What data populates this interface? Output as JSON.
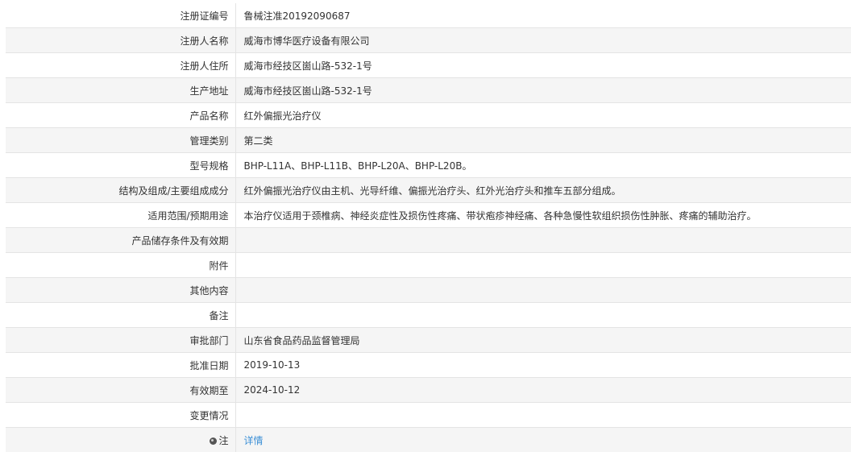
{
  "rows": [
    {
      "label": "注册证编号",
      "value": "鲁械注准20192090687"
    },
    {
      "label": "注册人名称",
      "value": "威海市博华医疗设备有限公司"
    },
    {
      "label": "注册人住所",
      "value": "威海市经技区崮山路-532-1号"
    },
    {
      "label": "生产地址",
      "value": "威海市经技区崮山路-532-1号"
    },
    {
      "label": "产品名称",
      "value": "红外偏振光治疗仪"
    },
    {
      "label": "管理类别",
      "value": "第二类"
    },
    {
      "label": "型号规格",
      "value": "BHP-L11A、BHP-L11B、BHP-L20A、BHP-L20B。"
    },
    {
      "label": "结构及组成/主要组成成分",
      "value": "红外偏振光治疗仪由主机、光导纤维、偏振光治疗头、红外光治疗头和推车五部分组成。"
    },
    {
      "label": "适用范围/预期用途",
      "value": "本治疗仪适用于颈椎病、神经炎症性及损伤性疼痛、带状疱疹神经痛、各种急慢性软组织损伤性肿胀、疼痛的辅助治疗。"
    },
    {
      "label": "产品储存条件及有效期",
      "value": ""
    },
    {
      "label": "附件",
      "value": ""
    },
    {
      "label": "其他内容",
      "value": ""
    },
    {
      "label": "备注",
      "value": ""
    },
    {
      "label": "审批部门",
      "value": "山东省食品药品监督管理局"
    },
    {
      "label": "批准日期",
      "value": "2019-10-13"
    },
    {
      "label": "有效期至",
      "value": "2024-10-12"
    },
    {
      "label": "变更情况",
      "value": ""
    }
  ],
  "note": {
    "icon": "note-icon",
    "label": "注",
    "link_text": "详情"
  }
}
